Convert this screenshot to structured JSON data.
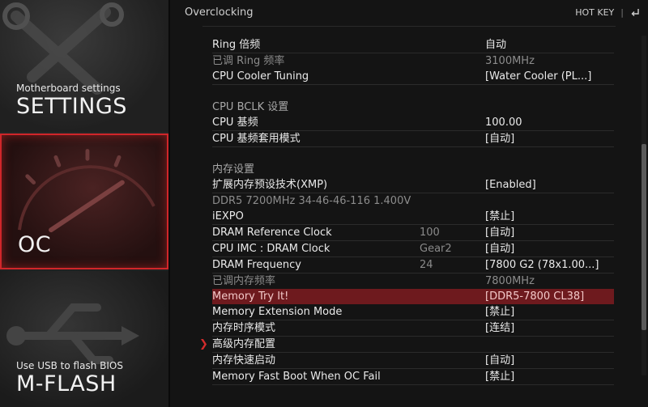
{
  "sidebar": {
    "settings": {
      "sub": "Motherboard settings",
      "title": "SETTINGS"
    },
    "oc": {
      "title": "OC"
    },
    "mflash": {
      "sub": "Use USB to flash BIOS",
      "title": "M-FLASH"
    }
  },
  "header": {
    "title": "Overclocking",
    "hotkey": "HOT KEY",
    "separator": "|",
    "back_icon": "return-arrow"
  },
  "rows": [
    {
      "label": "Ring 倍频",
      "val": "自动"
    },
    {
      "label": "已调 Ring 频率",
      "val": "3100MHz"
    },
    {
      "label": "CPU Cooler Tuning",
      "val": "[Water Cooler (PL...]"
    },
    {
      "section": "CPU  BCLK  设置"
    },
    {
      "label": "CPU 基频",
      "val": "100.00"
    },
    {
      "label": "CPU 基频套用模式",
      "val": "[自动]"
    },
    {
      "section": "内存设置"
    },
    {
      "label": "扩展内存预设技术(XMP)",
      "val": "[Enabled]"
    },
    {
      "label": "DDR5 7200MHz 34-46-46-116 1.400V"
    },
    {
      "label": "iEXPO",
      "val": "[禁止]"
    },
    {
      "label": "DRAM Reference Clock",
      "mid": "100",
      "val": "[自动]"
    },
    {
      "label": "CPU IMC : DRAM Clock",
      "mid": "Gear2",
      "val": "[自动]"
    },
    {
      "label": "DRAM Frequency",
      "mid": "24",
      "val": "[7800 G2 (78x1.00...]"
    },
    {
      "label": "已调内存频率",
      "val": "7800MHz"
    },
    {
      "label": "Memory Try It!",
      "val": "[DDR5-7800 CL38]"
    },
    {
      "label": "Memory Extension Mode",
      "val": "[禁止]"
    },
    {
      "label": "内存时序模式",
      "val": "[连结]"
    },
    {
      "label": "高级内存配置"
    },
    {
      "label": "内存快速启动",
      "val": "[自动]"
    },
    {
      "label": "Memory Fast Boot When OC Fail",
      "val": "[禁止]"
    }
  ],
  "colors": {
    "accent": "#d0262a",
    "selected_row": "#6e1a1e"
  }
}
